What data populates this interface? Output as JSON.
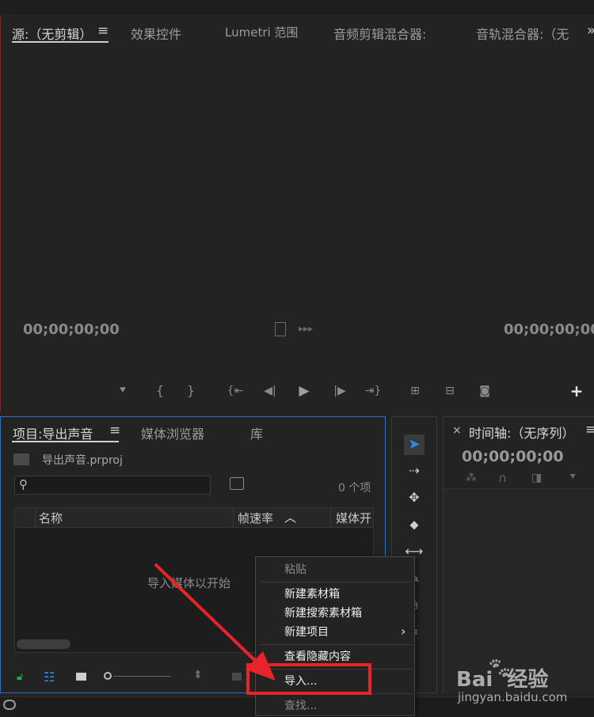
{
  "source_panel": {
    "tabs": [
      {
        "label": "源:（无剪辑）"
      },
      {
        "label": "效果控件"
      },
      {
        "label": "Lumetri 范围"
      },
      {
        "label": "音频剪辑混合器:"
      },
      {
        "label": "音轨混合器:（无"
      }
    ],
    "menu_icon": "≡",
    "overflow_icon": "»",
    "timecode_left": "00;00;00;00",
    "timecode_right": "00;00;00;00"
  },
  "project_panel": {
    "tabs": [
      {
        "label": "项目:导出声音"
      },
      {
        "label": "媒体浏览器"
      },
      {
        "label": "库"
      }
    ],
    "menu_icon": "≡",
    "project_file": "导出声音.prproj",
    "item_count": "0 个项",
    "columns": {
      "name": "名称",
      "fps": "帧速率",
      "media": "媒体开"
    },
    "empty_hint": "导入媒体以开始"
  },
  "timeline_panel": {
    "close_icon": "×",
    "title": "时间轴:（无序列）",
    "menu_icon": "≡",
    "timecode": "00;00;00;00"
  },
  "context_menu": {
    "items": [
      {
        "label": "粘贴",
        "disabled": true
      },
      {
        "label": "新建素材箱",
        "disabled": false
      },
      {
        "label": "新建搜索素材箱",
        "disabled": false
      },
      {
        "label": "新建项目",
        "disabled": false,
        "submenu": true
      },
      {
        "label": "查看隐藏内容",
        "disabled": false
      },
      {
        "label": "导入...",
        "disabled": false
      },
      {
        "label": "查找...",
        "disabled": true
      }
    ],
    "submenu_arrow": "›"
  },
  "watermark": {
    "brand": "Bai  经验",
    "url": "jingyan.baidu.com"
  },
  "colors": {
    "accent_blue": "#2d8ceb",
    "highlight_red": "#e8232a",
    "lock_green": "#2aa84a"
  }
}
